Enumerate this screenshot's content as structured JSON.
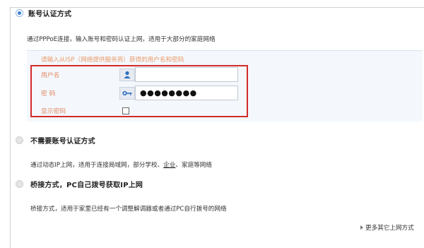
{
  "options": [
    {
      "title": "账号认证方式",
      "selected": true,
      "desc": "通过PPPoE连接，输入账号和密码认证上网，适用于大部分的家庭网络"
    },
    {
      "title": "不需要账号认证方式",
      "selected": false,
      "desc_parts": [
        "通过动态IP上网，适用于连接局域网，部分学校、",
        "企业",
        "、家庭等网络"
      ]
    },
    {
      "title": "桥接方式，PC自己拨号获取IP上网",
      "selected": false,
      "desc": "桥接方式，适用于家里已经有一个调整解调器或者通过PC自行拨号的网络"
    }
  ],
  "form": {
    "hint": "请输入从ISP（网络提供服务商）获得的用户名和密码",
    "username_label": "用户名",
    "username_value": "",
    "username_icon": "user-icon",
    "password_label": "密  码",
    "password_value": "●●●●●●●●",
    "password_icon": "key-icon",
    "show_password_label": "显示密码",
    "show_password_checked": false
  },
  "more_link": "更多其它上网方式",
  "colors": {
    "highlight_box": "#d42a2a",
    "radio_selected": "#3d7ed1",
    "hint_text": "#ea9a6a"
  }
}
